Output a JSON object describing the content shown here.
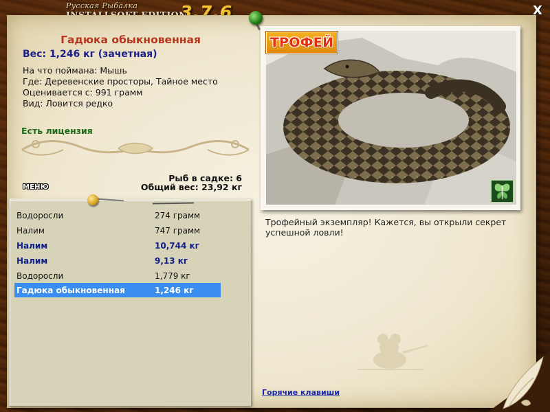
{
  "app": {
    "logo_subtitle": "Русская Рыбалка",
    "logo_edition": "INSTALLSOFT EDITION",
    "logo_version": "3.7.6",
    "close_label": "X"
  },
  "fish": {
    "title": "Гадюка обыкновенная",
    "weight_line": "Вес: 1,246 кг (зачетная)",
    "caught_on": "На что поймана: Мышь",
    "location": "Где: Деревенские просторы, Тайное место",
    "valued_from": "Оценивается с: 991 грамм",
    "rarity": "Вид: Ловится редко",
    "license": "Есть лицензия"
  },
  "keepnet": {
    "count": "Рыб в садке: 6",
    "total_weight": "Общий вес: 23,92 кг"
  },
  "menu_label": "МЕНЮ",
  "catch_list": [
    {
      "name": "Водоросли",
      "weight": "274 грамм",
      "trophy": false,
      "selected": false
    },
    {
      "name": "Налим",
      "weight": "747 грамм",
      "trophy": false,
      "selected": false
    },
    {
      "name": "Налим",
      "weight": "10,744 кг",
      "trophy": true,
      "selected": false
    },
    {
      "name": "Налим",
      "weight": "9,13 кг",
      "trophy": true,
      "selected": false
    },
    {
      "name": "Водоросли",
      "weight": "1,779 кг",
      "trophy": false,
      "selected": false
    },
    {
      "name": "Гадюка обыкновенная",
      "weight": "1,246 кг",
      "trophy": true,
      "selected": true
    }
  ],
  "photo": {
    "badge": "ТРОФЕЙ",
    "corner_icon": "butterfly-icon"
  },
  "trophy_message": "Трофейный экземпляр! Кажется, вы открыли секрет успешной ловли!",
  "hotkeys_link": "Горячие клавиши",
  "colors": {
    "title_red": "#b5351e",
    "weight_blue": "#1a1f8a",
    "license_green": "#1a6b1a",
    "selection_blue": "#3a8ef0",
    "link_blue": "#1b2ba8",
    "badge_orange": "#f3b020"
  }
}
